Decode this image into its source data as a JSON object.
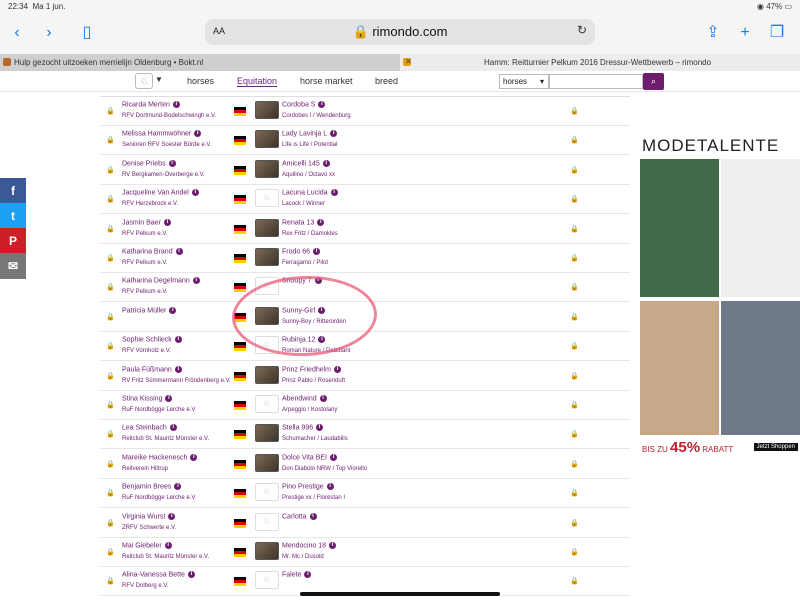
{
  "status": {
    "time": "22:34",
    "date": "Ma 1 jun.",
    "battery": "47%"
  },
  "browser": {
    "aa_label": "AA",
    "url": "rimondo.com",
    "tabs": [
      {
        "title": "Hulp gezocht uitzoeken merrielijn Oldenburg • Bokt.nl",
        "active": false
      },
      {
        "title": "Hamm: Reitturnier Pelkum 2016 Dressur-Wettbewerb – rimondo",
        "active": true
      }
    ],
    "close_glyph": "✕"
  },
  "nav": {
    "items": [
      "horses",
      "Equitation",
      "horse market",
      "breed"
    ],
    "active": "Equitation",
    "search_select": "horses"
  },
  "social": [
    {
      "icon": "facebook-icon",
      "glyph": "f",
      "color": "#3b5998"
    },
    {
      "icon": "twitter-icon",
      "glyph": "t",
      "color": "#1da1f2"
    },
    {
      "icon": "pinterest-icon",
      "glyph": "P",
      "color": "#cb2027"
    },
    {
      "icon": "mail-icon",
      "glyph": "✉",
      "color": "#777777"
    }
  ],
  "results": [
    {
      "rider": "Ricarda Merten",
      "club": "RFV Dortmund-Bodelschwingh e.V.",
      "horse": "Cordoba S",
      "pedigree": "Cordobes I / Wendenburg",
      "photo": true
    },
    {
      "rider": "Melissa Hammwöhner",
      "club": "Senioren RFV Soester Börde e.V.",
      "horse": "Lady Lavinja L",
      "pedigree": "Life is Life / Potential",
      "photo": true
    },
    {
      "rider": "Denise Priebs",
      "club": "RV Bergkamen-Overberge e.V.",
      "horse": "Amicelli 145",
      "pedigree": "Aquilino / Octavo xx",
      "photo": true
    },
    {
      "rider": "Jacqueline Van Andel",
      "club": "RFV Herzebrock e.V.",
      "horse": "Lacuna Lucida",
      "pedigree": "Lacock / Winner",
      "photo": false
    },
    {
      "rider": "Jasmin Baer",
      "club": "RFV Pelkum e.V.",
      "horse": "Renata 13",
      "pedigree": "Rex Fritz / Damokles",
      "photo": true
    },
    {
      "rider": "Katharina Brand",
      "club": "RFV Pelkum e.V.",
      "horse": "Frodo 66",
      "pedigree": "Ferragamo / Pilot",
      "photo": true
    },
    {
      "rider": "Katharina Degelmann",
      "club": "RFV Pelkum e.V.",
      "horse": "Snoopy 7",
      "pedigree": "",
      "photo": false
    },
    {
      "rider": "Patricia Müller",
      "club": "",
      "horse": "Sunny-Girl",
      "pedigree": "Sunny-Boy / Ritterorden",
      "photo": true
    },
    {
      "rider": "Sophie Schlieck",
      "club": "RFV Vornholz e.V.",
      "horse": "Rubinja 12",
      "pedigree": "Roman Nature / Debütant",
      "photo": false
    },
    {
      "rider": "Paula Füßmann",
      "club": "RV Fritz Sümmermann Fröndenberg e.V.",
      "horse": "Prinz Friedhelm",
      "pedigree": "Prinz Pablo / Rosenduft",
      "photo": true
    },
    {
      "rider": "Stina Kissing",
      "club": "RuF Nordbögge Lerche e.V",
      "horse": "Abendwind",
      "pedigree": "Arpeggio / Kostolany",
      "photo": false
    },
    {
      "rider": "Lea Steinbach",
      "club": "Reitclub St. Mauritz Münster e.V.",
      "horse": "Stella 996",
      "pedigree": "Schumacher / Laudabilis",
      "photo": true
    },
    {
      "rider": "Mareike Hackenesch",
      "club": "Reitverein Hiltrup",
      "horse": "Dolce Vita BEI",
      "pedigree": "Don Diabolo NRW / Top Viorello",
      "photo": true
    },
    {
      "rider": "Benjamin Brees",
      "club": "RuF Nordbögge Lerche e.V",
      "horse": "Pino Prestige",
      "pedigree": "Prestige xx / Florestan I",
      "photo": false
    },
    {
      "rider": "Virginia Wurst",
      "club": "ZRFV Schwerte e.V.",
      "horse": "Carlotta",
      "pedigree": "",
      "photo": false
    },
    {
      "rider": "Mai Giebeler",
      "club": "Reitclub St. Mauritz Münster e.V.",
      "horse": "Mendocino 18",
      "pedigree": "Mr. Mc / Dusold",
      "photo": true
    },
    {
      "rider": "Alina-Vanessa Bette",
      "club": "RFV Dolberg e.V.",
      "horse": "Falete",
      "pedigree": "",
      "photo": false
    }
  ],
  "ad": {
    "title": "MODETALENTE",
    "bottom_prefix": "BIS ZU",
    "bottom_percent": "45%",
    "bottom_suffix": "RABATT",
    "button": "Jetzt Shoppen"
  }
}
